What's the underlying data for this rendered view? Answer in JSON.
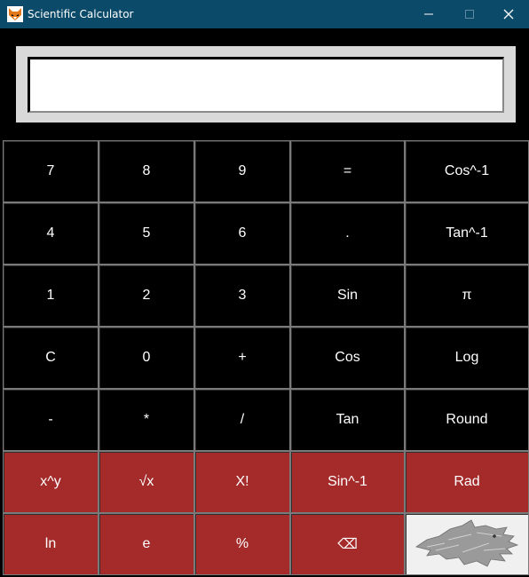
{
  "window": {
    "title": "Scientific Calculator",
    "icon": "fox-icon",
    "controls": {
      "minimize": "—",
      "maximize": "☐",
      "close": "✕"
    }
  },
  "display": {
    "value": ""
  },
  "keys": [
    [
      "7",
      "8",
      "9",
      "=",
      "Cos^-1"
    ],
    [
      "4",
      "5",
      "6",
      ".",
      "Tan^-1"
    ],
    [
      "1",
      "2",
      "3",
      "Sin",
      "π"
    ],
    [
      "C",
      "0",
      "+",
      "Cos",
      "Log"
    ],
    [
      "-",
      "*",
      "/",
      "Tan",
      "Round"
    ],
    [
      "x^y",
      "√x",
      "X!",
      "Sin^-1",
      "Rad"
    ],
    [
      "ln",
      "e",
      "%",
      "⌫",
      ""
    ]
  ],
  "last_key_image": "wolf-emblem-image",
  "colors": {
    "titlebar": "#0c4a6a",
    "key_bg": "#000000",
    "key_red": "#a52a2a",
    "key_text": "#ffffff",
    "display_bevel": "#d9d9d9"
  }
}
